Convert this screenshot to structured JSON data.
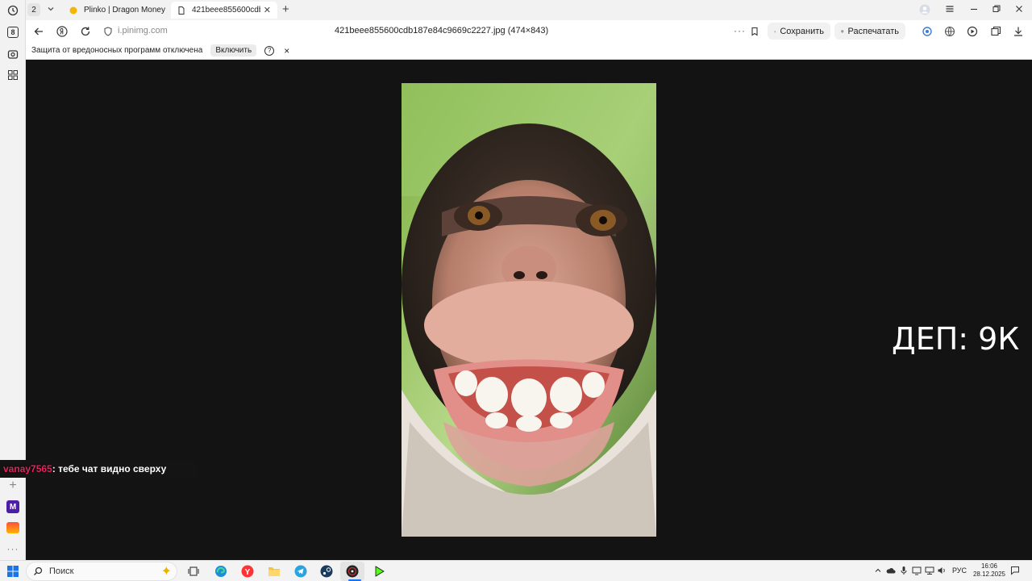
{
  "browser": {
    "tab_count": "2",
    "tabs": [
      {
        "title": "Plinko | Dragon Money"
      },
      {
        "title": "421beee855600cdb187"
      }
    ],
    "address": {
      "domain": "i.pinimg.com",
      "page_title": "421beee855600cdb187e84c9669c2227.jpg (474×843)",
      "save_label": "Сохранить",
      "print_label": "Распечатать"
    },
    "protection": {
      "message": "Защита от вредоносных программ отключена",
      "enable_label": "Включить",
      "help_label": "?",
      "close_label": "×"
    },
    "sidebar_badge": "8"
  },
  "overlay": {
    "deposit_text": "ДЕП: 9К",
    "chat": {
      "username": "vanay7565",
      "message": " : тебе чат видно сверху"
    }
  },
  "taskbar": {
    "search_placeholder": "Поиск",
    "language": "РУС",
    "time": "16:06",
    "date": "28.12.2025"
  },
  "colors": {
    "viewer_background": "#131313",
    "chat_username": "#e0245e",
    "accent": "#1a73e8"
  }
}
